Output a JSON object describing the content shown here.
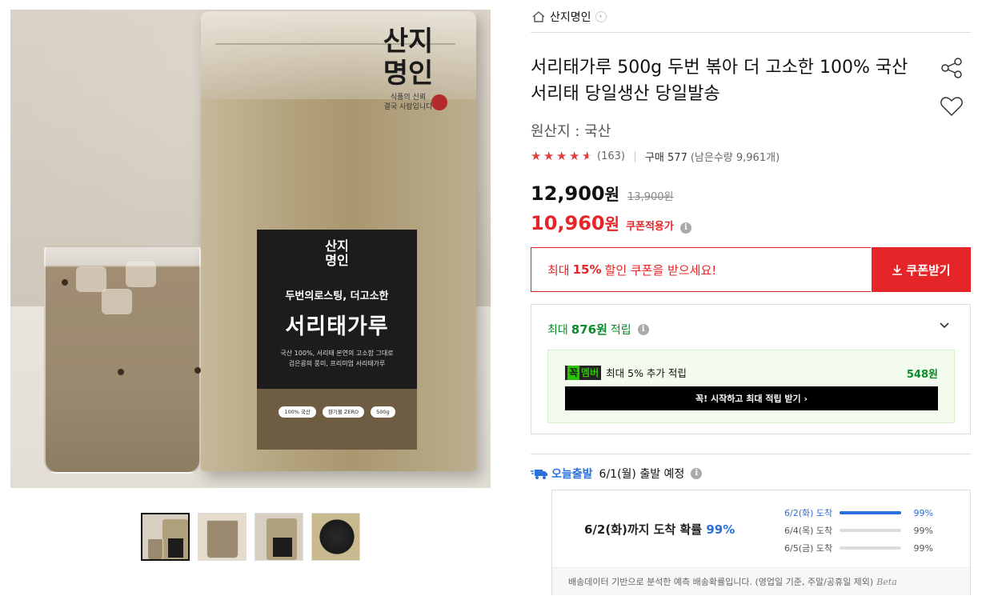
{
  "gallery": {
    "main_alt": "서리태가루 제품 이미지",
    "bag_logo": "산지\n명인",
    "bag_logo_sub": "식품의 신뢰\n결국 사람입니다",
    "label_logo": "산지\n명인",
    "label_subtitle": "두번의로스팅, 더고소한",
    "label_title": "서리태가루",
    "label_desc": "국산 100%, 서리태 본연의 고소함 그대로\n검은콩의 풍미, 프리미엄 서리태가루",
    "label_badges": [
      "100% 국산",
      "향기불 ZERO",
      "500g"
    ],
    "thumbs": [
      "thumb-1",
      "thumb-2",
      "thumb-3",
      "thumb-4"
    ]
  },
  "product": {
    "brand": "산지명인",
    "title": "서리태가루 500g 두번 볶아 더 고소한 100% 국산 서리태 당일생산 당일발송",
    "origin": "원산지 : 국산",
    "rating": 4.5,
    "review_count": "(163)",
    "purchase": "구매 577",
    "stock": "(남은수량 9,961개)",
    "price": "12,900",
    "price_unit": "원",
    "original_price": "13,900원",
    "coupon_price": "10,960",
    "coupon_unit": "원",
    "coupon_tag": "쿠폰적용가"
  },
  "coupon": {
    "prefix": "최대",
    "percent": "15%",
    "suffix": "할인 쿠폰을 받으세요!",
    "button": "쿠폰받기"
  },
  "points": {
    "prefix": "최대",
    "amount": "876원",
    "suffix": "적립",
    "member_badge_1": "꼭",
    "member_badge_2": "멤버",
    "member_text": "최대 5% 추가 적립",
    "member_amount": "548원",
    "member_button": "꼭! 시작하고 최대 적립 받기 ›"
  },
  "shipping": {
    "tag": "오늘출발",
    "text": "6/1(월) 출발 예정",
    "headline_prefix": "6/2(화)까지 도착 확률",
    "headline_pct": "99%",
    "items": [
      {
        "date": "6/2(화) 도착",
        "pct": "99%",
        "fill": 1.0
      },
      {
        "date": "6/4(목) 도착",
        "pct": "99%",
        "fill": 0.0
      },
      {
        "date": "6/5(금) 도착",
        "pct": "99%",
        "fill": 0.0
      }
    ],
    "footnote": "배송데이터 기반으로 분석한 예측 배송확률입니다. (영업일 기준, 주말/공휴일 제외)",
    "beta": "Beta"
  },
  "colors": {
    "accent_red": "#e52528",
    "accent_green": "#0a8a2a",
    "accent_blue": "#2a6fdb",
    "star": "#e03c3c"
  }
}
